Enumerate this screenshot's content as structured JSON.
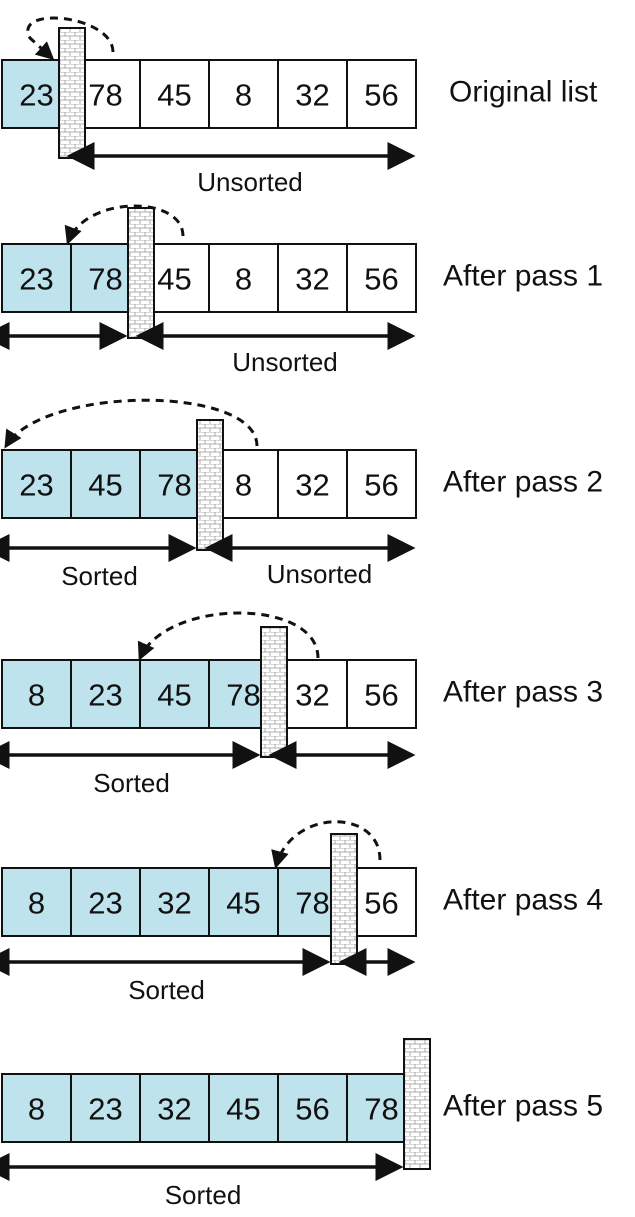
{
  "colors": {
    "sorted_fill": "#bfe3ed",
    "unsorted_fill": "#ffffff",
    "stroke": "#111111"
  },
  "rows": [
    {
      "label": "Original list",
      "values": [
        "23",
        "78",
        "45",
        "8",
        "32",
        "56"
      ],
      "sorted_count": 1,
      "left_caption": "",
      "right_caption": "Unsorted"
    },
    {
      "label": "After pass 1",
      "values": [
        "23",
        "78",
        "45",
        "8",
        "32",
        "56"
      ],
      "sorted_count": 2,
      "left_caption": "",
      "right_caption": "Unsorted"
    },
    {
      "label": "After pass 2",
      "values": [
        "23",
        "45",
        "78",
        "8",
        "32",
        "56"
      ],
      "sorted_count": 3,
      "left_caption": "Sorted",
      "right_caption": "Unsorted"
    },
    {
      "label": "After pass 3",
      "values": [
        "8",
        "23",
        "45",
        "78",
        "32",
        "56"
      ],
      "sorted_count": 4,
      "left_caption": "Sorted",
      "right_caption": ""
    },
    {
      "label": "After pass 4",
      "values": [
        "8",
        "23",
        "32",
        "45",
        "78",
        "56"
      ],
      "sorted_count": 5,
      "left_caption": "Sorted",
      "right_caption": ""
    },
    {
      "label": "After pass 5",
      "values": [
        "8",
        "23",
        "32",
        "45",
        "56",
        "78"
      ],
      "sorted_count": 6,
      "left_caption": "Sorted",
      "right_caption": ""
    }
  ]
}
